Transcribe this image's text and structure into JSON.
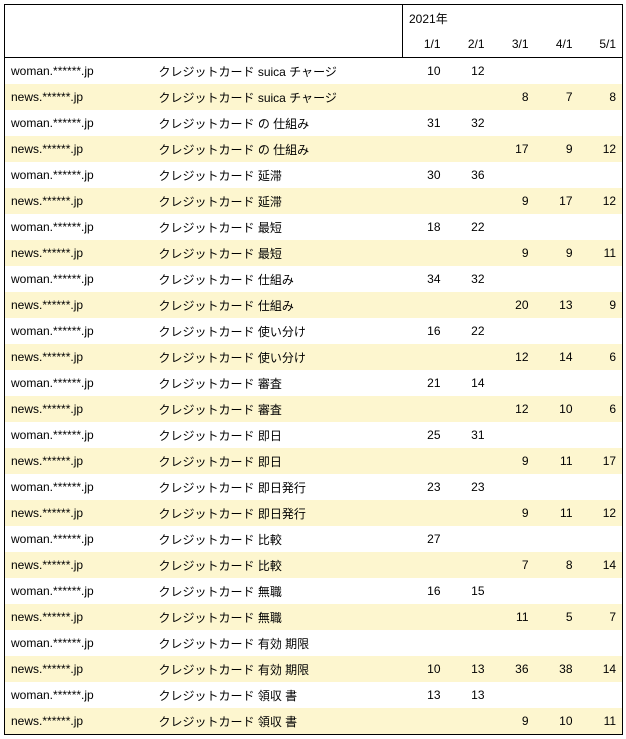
{
  "header": {
    "year_label": "2021年",
    "date_labels": [
      "1/1",
      "2/1",
      "3/1",
      "4/1",
      "5/1"
    ]
  },
  "rows": [
    {
      "domain": "woman.******.jp",
      "keyword": "クレジットカード suica チャージ",
      "values": [
        "10",
        "12",
        "",
        "",
        ""
      ]
    },
    {
      "domain": "news.******.jp",
      "keyword": "クレジットカード suica チャージ",
      "values": [
        "",
        "",
        "8",
        "7",
        "8"
      ]
    },
    {
      "domain": "woman.******.jp",
      "keyword": "クレジットカード の 仕組み",
      "values": [
        "31",
        "32",
        "",
        "",
        ""
      ]
    },
    {
      "domain": "news.******.jp",
      "keyword": "クレジットカード の 仕組み",
      "values": [
        "",
        "",
        "17",
        "9",
        "12"
      ]
    },
    {
      "domain": "woman.******.jp",
      "keyword": "クレジットカード 延滞",
      "values": [
        "30",
        "36",
        "",
        "",
        ""
      ]
    },
    {
      "domain": "news.******.jp",
      "keyword": "クレジットカード 延滞",
      "values": [
        "",
        "",
        "9",
        "17",
        "12"
      ]
    },
    {
      "domain": "woman.******.jp",
      "keyword": "クレジットカード 最短",
      "values": [
        "18",
        "22",
        "",
        "",
        ""
      ]
    },
    {
      "domain": "news.******.jp",
      "keyword": "クレジットカード 最短",
      "values": [
        "",
        "",
        "9",
        "9",
        "11"
      ]
    },
    {
      "domain": "woman.******.jp",
      "keyword": "クレジットカード 仕組み",
      "values": [
        "34",
        "32",
        "",
        "",
        ""
      ]
    },
    {
      "domain": "news.******.jp",
      "keyword": "クレジットカード 仕組み",
      "values": [
        "",
        "",
        "20",
        "13",
        "9"
      ]
    },
    {
      "domain": "woman.******.jp",
      "keyword": "クレジットカード 使い分け",
      "values": [
        "16",
        "22",
        "",
        "",
        ""
      ]
    },
    {
      "domain": "news.******.jp",
      "keyword": "クレジットカード 使い分け",
      "values": [
        "",
        "",
        "12",
        "14",
        "6"
      ]
    },
    {
      "domain": "woman.******.jp",
      "keyword": "クレジットカード 審査",
      "values": [
        "21",
        "14",
        "",
        "",
        ""
      ]
    },
    {
      "domain": "news.******.jp",
      "keyword": "クレジットカード 審査",
      "values": [
        "",
        "",
        "12",
        "10",
        "6"
      ]
    },
    {
      "domain": "woman.******.jp",
      "keyword": "クレジットカード 即日",
      "values": [
        "25",
        "31",
        "",
        "",
        ""
      ]
    },
    {
      "domain": "news.******.jp",
      "keyword": "クレジットカード 即日",
      "values": [
        "",
        "",
        "9",
        "11",
        "17"
      ]
    },
    {
      "domain": "woman.******.jp",
      "keyword": "クレジットカード 即日発行",
      "values": [
        "23",
        "23",
        "",
        "",
        ""
      ]
    },
    {
      "domain": "news.******.jp",
      "keyword": "クレジットカード 即日発行",
      "values": [
        "",
        "",
        "9",
        "11",
        "12"
      ]
    },
    {
      "domain": "woman.******.jp",
      "keyword": "クレジットカード 比較",
      "values": [
        "27",
        "",
        "",
        "",
        ""
      ]
    },
    {
      "domain": "news.******.jp",
      "keyword": "クレジットカード 比較",
      "values": [
        "",
        "",
        "7",
        "8",
        "14"
      ]
    },
    {
      "domain": "woman.******.jp",
      "keyword": "クレジットカード 無職",
      "values": [
        "16",
        "15",
        "",
        "",
        ""
      ]
    },
    {
      "domain": "news.******.jp",
      "keyword": "クレジットカード 無職",
      "values": [
        "",
        "",
        "11",
        "5",
        "7"
      ]
    },
    {
      "domain": "woman.******.jp",
      "keyword": "クレジットカード 有効 期限",
      "values": [
        "",
        "",
        "",
        "",
        ""
      ]
    },
    {
      "domain": "news.******.jp",
      "keyword": "クレジットカード 有効 期限",
      "values": [
        "10",
        "13",
        "36",
        "38",
        "14"
      ]
    },
    {
      "domain": "woman.******.jp",
      "keyword": "クレジットカード 領収 書",
      "values": [
        "13",
        "13",
        "",
        "",
        ""
      ]
    },
    {
      "domain": "news.******.jp",
      "keyword": "クレジットカード 領収 書",
      "values": [
        "",
        "",
        "9",
        "10",
        "11"
      ]
    }
  ]
}
